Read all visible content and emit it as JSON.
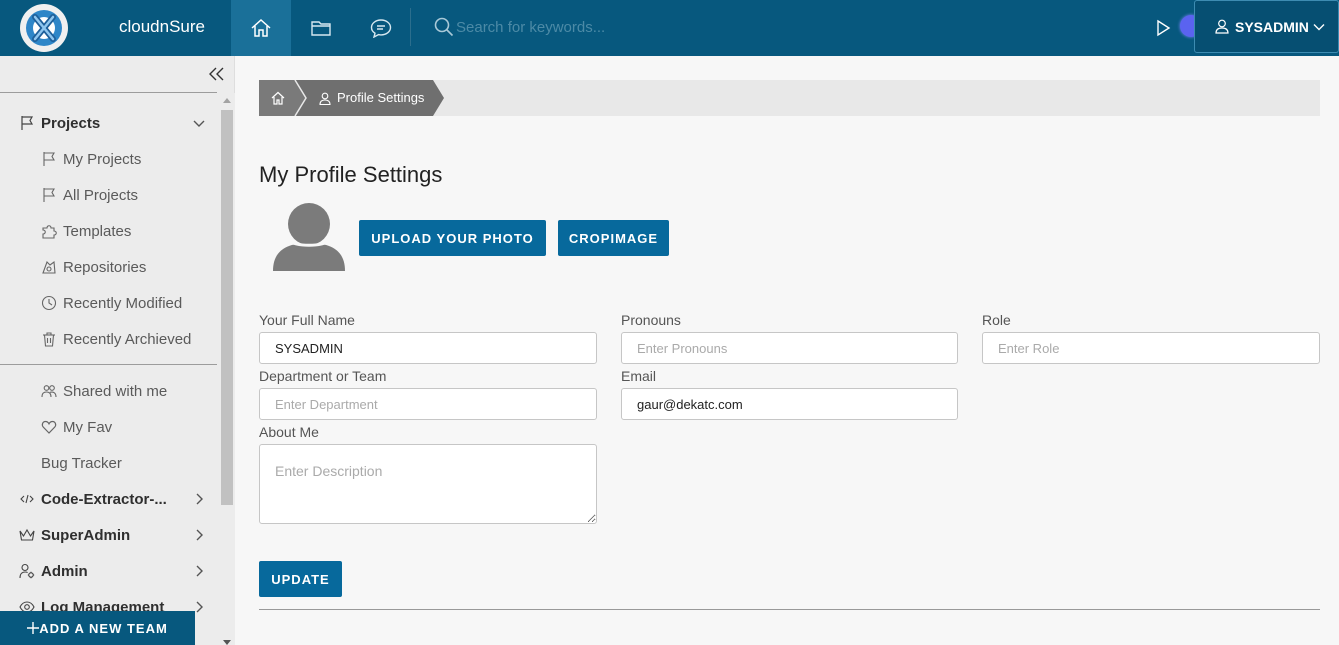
{
  "app": {
    "brand": "cloudnSure"
  },
  "topbar": {
    "search_placeholder": "Search for keywords...",
    "user_name": "SYSADMIN",
    "nav_icons": [
      "home-icon",
      "folder-icon",
      "chat-icon"
    ]
  },
  "sidebar": {
    "projects": {
      "label": "Projects",
      "items": [
        {
          "label": "My Projects",
          "icon": "flag-icon"
        },
        {
          "label": "All Projects",
          "icon": "flag-icon"
        },
        {
          "label": "Templates",
          "icon": "puzzle-icon"
        },
        {
          "label": "Repositories",
          "icon": "repository-icon"
        },
        {
          "label": "Recently Modified",
          "icon": "clock-icon"
        },
        {
          "label": "Recently Archieved",
          "icon": "trash-icon"
        }
      ]
    },
    "secondary": [
      {
        "label": "Shared with me",
        "icon": "users-icon"
      },
      {
        "label": "My Fav",
        "icon": "heart-icon"
      },
      {
        "label": "Bug Tracker",
        "icon": ""
      }
    ],
    "groups": [
      {
        "label": "Code-Extractor-...",
        "icon": "code-icon"
      },
      {
        "label": "SuperAdmin",
        "icon": "crown-icon"
      },
      {
        "label": "Admin",
        "icon": "user-gear-icon"
      },
      {
        "label": "Log Management",
        "icon": "eye-icon"
      }
    ],
    "add_team_label": "ADD A NEW TEAM"
  },
  "breadcrumb": {
    "current": "Profile Settings"
  },
  "main": {
    "title": "My Profile Settings",
    "upload_label": "UPLOAD YOUR PHOTO",
    "crop_label": "CROPIMAGE",
    "update_label": "UPDATE",
    "fields": {
      "full_name": {
        "label": "Your Full Name",
        "value": "SYSADMIN",
        "placeholder": ""
      },
      "pronouns": {
        "label": "Pronouns",
        "value": "",
        "placeholder": "Enter Pronouns"
      },
      "role": {
        "label": "Role",
        "value": "",
        "placeholder": "Enter Role"
      },
      "department": {
        "label": "Department or Team",
        "value": "",
        "placeholder": "Enter Department"
      },
      "email": {
        "label": "Email",
        "value": "gaur@dekatc.com",
        "placeholder": ""
      },
      "about": {
        "label": "About Me",
        "value": "",
        "placeholder": "Enter Description"
      }
    }
  },
  "colors": {
    "primary": "#07587e",
    "button": "#07699c",
    "accent_dot": "#5a63f0"
  }
}
